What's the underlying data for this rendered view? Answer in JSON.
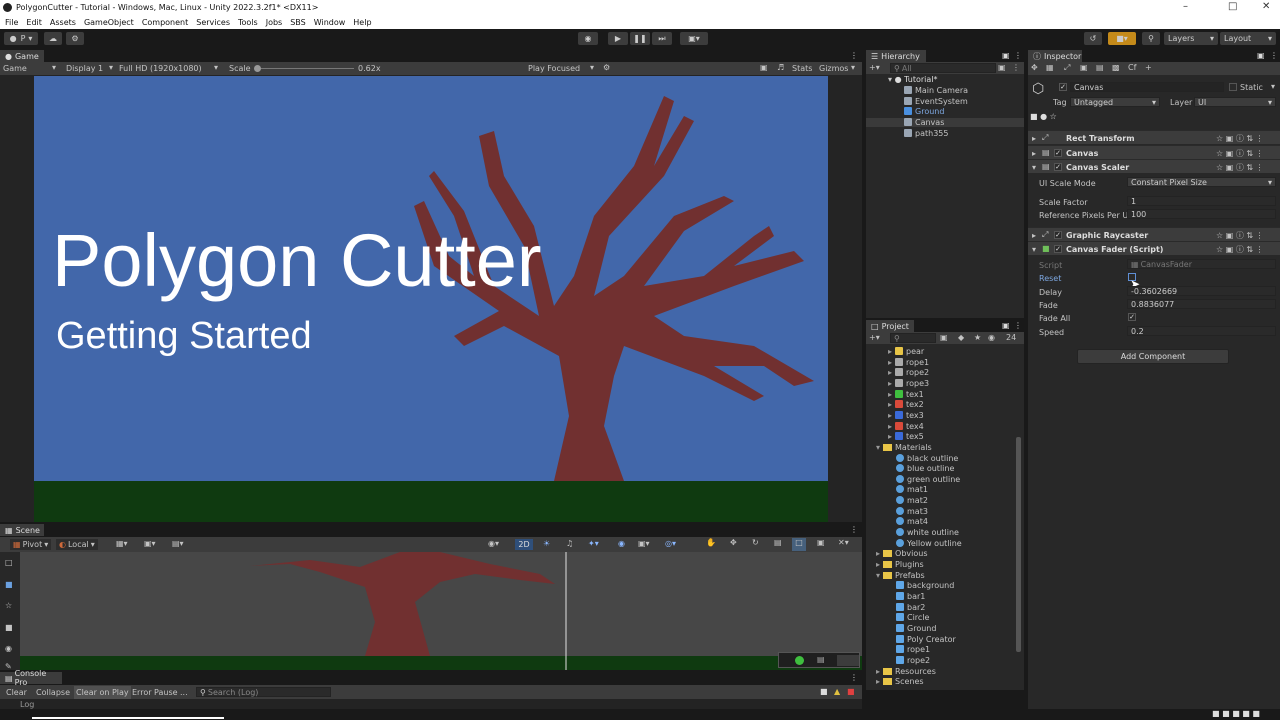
{
  "window": {
    "title": "PolygonCutter - Tutorial - Windows, Mac, Linux - Unity 2022.3.2f1* <DX11>"
  },
  "menu": [
    "File",
    "Edit",
    "Assets",
    "GameObject",
    "Component",
    "Services",
    "Tools",
    "Jobs",
    "SBS",
    "Window",
    "Help"
  ],
  "toolbar": {
    "account": "P",
    "layers": "Layers",
    "layout": "Layout"
  },
  "game": {
    "tab": "Game",
    "mode": "Game",
    "display": "Display 1",
    "resolution": "Full HD (1920x1080)",
    "scale_label": "Scale",
    "scale_value": "0.62x",
    "play_focused": "Play Focused",
    "stats": "Stats",
    "gizmos": "Gizmos",
    "heading": "Polygon Cutter",
    "subheading": "Getting Started",
    "sky_color": "#4267aa",
    "ground_color": "#0f3a10",
    "tree_color": "#713030"
  },
  "scene": {
    "tab": "Scene",
    "pivot": "Pivot",
    "local": "Local",
    "mode2d": "2D"
  },
  "console": {
    "tab": "Console Pro",
    "clear": "Clear",
    "collapse": "Collapse",
    "clear_on_play": "Clear on Play",
    "error_pause": "Error Pause",
    "more": "...",
    "search_placeholder": "Search (Log)",
    "log": "Log"
  },
  "hierarchy": {
    "tab": "Hierarchy",
    "search_placeholder": "All",
    "scene": "Tutorial*",
    "items": [
      {
        "label": "Main Camera",
        "selected": false
      },
      {
        "label": "EventSystem",
        "selected": false
      },
      {
        "label": "Ground",
        "selected": true
      },
      {
        "label": "Canvas",
        "selected": false
      },
      {
        "label": "path355",
        "selected": false
      }
    ]
  },
  "project": {
    "tab": "Project",
    "count": "24",
    "items": [
      {
        "label": "pear",
        "kind": "asset",
        "color": "#e8c547"
      },
      {
        "label": "rope1",
        "kind": "asset",
        "color": "#aaaaaa"
      },
      {
        "label": "rope2",
        "kind": "asset",
        "color": "#aaaaaa"
      },
      {
        "label": "rope3",
        "kind": "asset",
        "color": "#aaaaaa"
      },
      {
        "label": "tex1",
        "kind": "asset",
        "color": "#3fbf3f"
      },
      {
        "label": "tex2",
        "kind": "asset",
        "color": "#d94a3a"
      },
      {
        "label": "tex3",
        "kind": "asset",
        "color": "#3a6ad9"
      },
      {
        "label": "tex4",
        "kind": "asset",
        "color": "#d94a3a"
      },
      {
        "label": "tex5",
        "kind": "asset",
        "color": "#3a6ad9"
      },
      {
        "label": "Materials",
        "kind": "folder-open"
      },
      {
        "label": "black outline",
        "kind": "material"
      },
      {
        "label": "blue outline",
        "kind": "material"
      },
      {
        "label": "green outline",
        "kind": "material"
      },
      {
        "label": "mat1",
        "kind": "material"
      },
      {
        "label": "mat2",
        "kind": "material"
      },
      {
        "label": "mat3",
        "kind": "material"
      },
      {
        "label": "mat4",
        "kind": "material"
      },
      {
        "label": "white outline",
        "kind": "material"
      },
      {
        "label": "Yellow outline",
        "kind": "material"
      },
      {
        "label": "Obvious",
        "kind": "folder"
      },
      {
        "label": "Plugins",
        "kind": "folder"
      },
      {
        "label": "Prefabs",
        "kind": "folder-open"
      },
      {
        "label": "background",
        "kind": "prefab"
      },
      {
        "label": "bar1",
        "kind": "prefab"
      },
      {
        "label": "bar2",
        "kind": "prefab"
      },
      {
        "label": "Circle",
        "kind": "prefab"
      },
      {
        "label": "Ground",
        "kind": "prefab"
      },
      {
        "label": "Poly Creator",
        "kind": "prefab"
      },
      {
        "label": "rope1",
        "kind": "prefab"
      },
      {
        "label": "rope2",
        "kind": "prefab"
      },
      {
        "label": "Resources",
        "kind": "folder"
      },
      {
        "label": "Scenes",
        "kind": "folder"
      }
    ]
  },
  "inspector": {
    "tab": "Inspector",
    "object_name": "Canvas",
    "static_label": "Static",
    "tag_label": "Tag",
    "tag_value": "Untagged",
    "layer_label": "Layer",
    "layer_value": "UI",
    "components": {
      "rect_transform": "Rect Transform",
      "canvas": "Canvas",
      "canvas_scaler": "Canvas Scaler",
      "graphic_raycaster": "Graphic Raycaster",
      "canvas_fader": "Canvas Fader (Script)"
    },
    "scaler": {
      "ui_scale_mode_label": "UI Scale Mode",
      "ui_scale_mode_value": "Constant Pixel Size",
      "scale_factor_label": "Scale Factor",
      "scale_factor_value": "1",
      "ref_ppu_label": "Reference Pixels Per Ui",
      "ref_ppu_value": "100"
    },
    "fader": {
      "script_label": "Script",
      "script_value": "CanvasFader",
      "reset_label": "Reset",
      "delay_label": "Delay",
      "delay_value": "-0.3602669",
      "fade_label": "Fade",
      "fade_value": "0.8836077",
      "fade_all_label": "Fade All",
      "speed_label": "Speed",
      "speed_value": "0.2"
    },
    "add_component": "Add Component"
  }
}
